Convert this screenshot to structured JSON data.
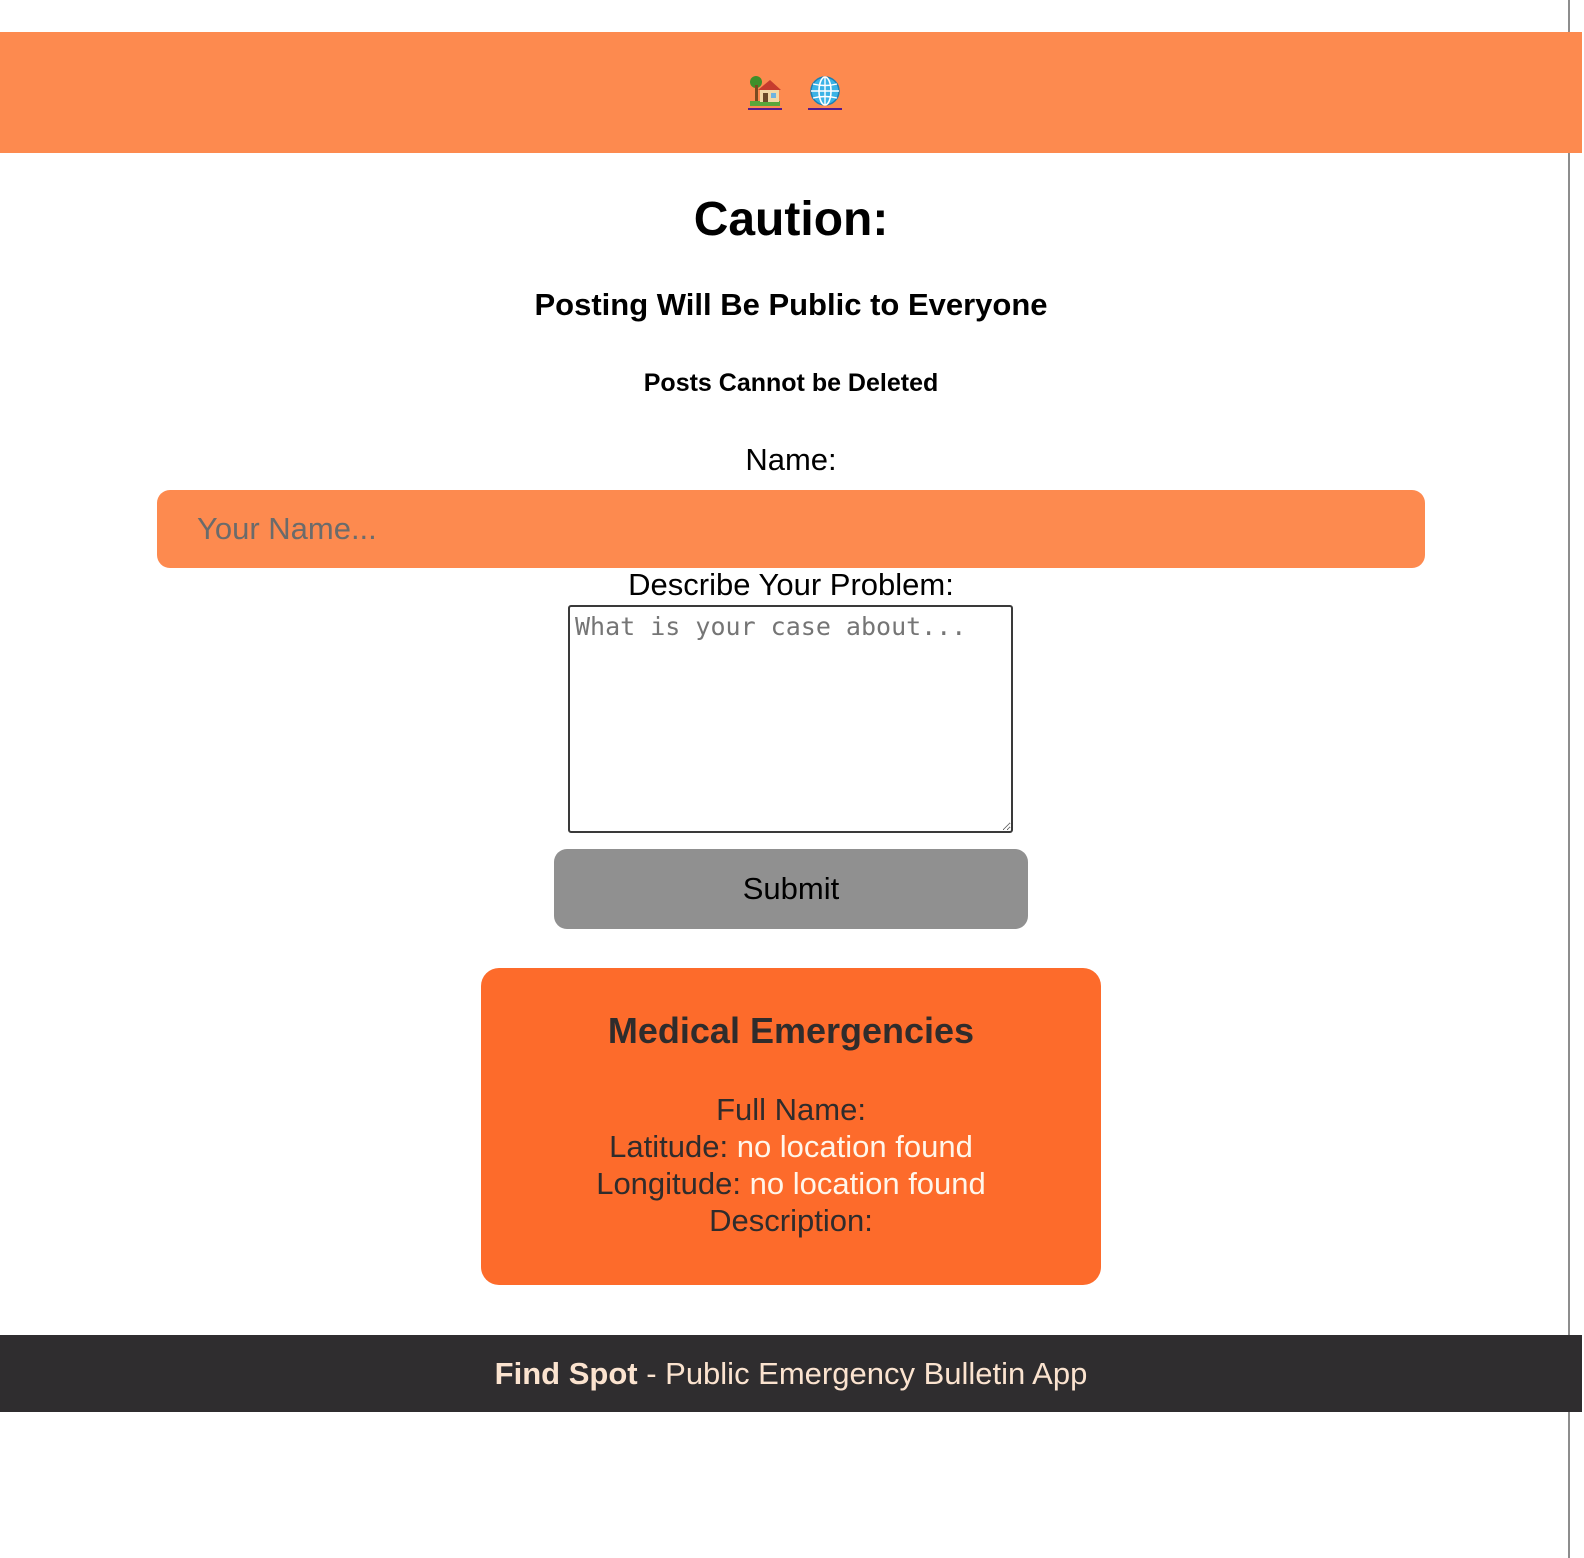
{
  "nav": {
    "links": [
      {
        "icon": "house-with-garden-icon"
      },
      {
        "icon": "globe-icon"
      }
    ]
  },
  "caution": {
    "title": "Caution:",
    "subtitle": "Posting Will Be Public to Everyone",
    "note": "Posts Cannot be Deleted"
  },
  "form": {
    "name_label": "Name:",
    "name_placeholder": "Your Name...",
    "name_value": "",
    "desc_label": "Describe Your Problem:",
    "desc_placeholder": "What is your case about...",
    "desc_value": "",
    "submit_label": "Submit"
  },
  "card": {
    "title": "Medical Emergencies",
    "full_name_label": "Full Name:",
    "full_name_value": "",
    "latitude_label": "Latitude:",
    "latitude_value": "no location found",
    "longitude_label": "Longitude:",
    "longitude_value": "no location found",
    "description_label": "Description:",
    "description_value": ""
  },
  "footer": {
    "brand": "Find Spot",
    "separator": " - ",
    "tagline": "Public Emergency Bulletin App"
  },
  "colors": {
    "header_bg": "#fd8a4f",
    "input_bg": "#fd8a4f",
    "card_bg": "#fd6b2b",
    "button_bg": "#909090",
    "footer_bg": "#2f2d2f",
    "footer_text": "#fbe3cf"
  }
}
